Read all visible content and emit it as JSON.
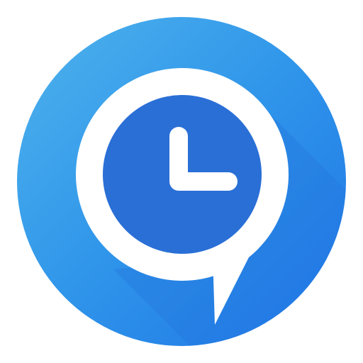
{
  "icon": {
    "name": "clock-chat-bubble-app-icon",
    "colors": {
      "background": "#ffffff",
      "circle_light": "#4fb3ec",
      "circle_mid": "#2f95ea",
      "circle_dark": "#1f74e6",
      "bubble": "#ffffff",
      "clock_face": "#2a6fd6",
      "clock_hands": "#ffffff",
      "long_shadow": "#1b5fcf"
    },
    "clock_reading": "3:00"
  }
}
